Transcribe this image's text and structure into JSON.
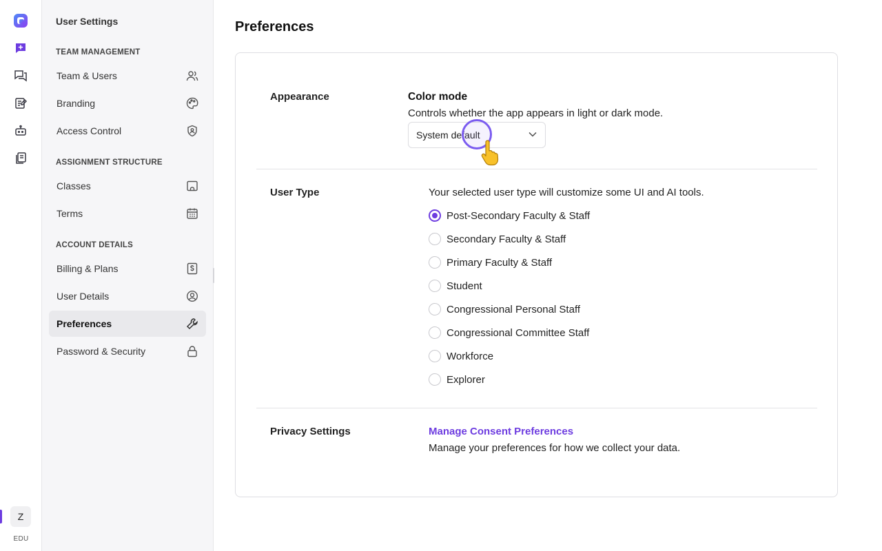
{
  "rail": {
    "items": [
      {
        "name": "logo-icon"
      },
      {
        "name": "new-chat-icon"
      },
      {
        "name": "chats-icon"
      },
      {
        "name": "notes-icon"
      },
      {
        "name": "bot-icon"
      },
      {
        "name": "documents-icon"
      }
    ],
    "avatar_letter": "Z",
    "plan_badge": "EDU",
    "accent_color": "#6d3ce0"
  },
  "sidebar": {
    "title": "User Settings",
    "sections": [
      {
        "heading": "TEAM MANAGEMENT",
        "items": [
          {
            "label": "Team & Users",
            "icon": "users-icon"
          },
          {
            "label": "Branding",
            "icon": "palette-icon"
          },
          {
            "label": "Access Control",
            "icon": "shield-icon"
          }
        ]
      },
      {
        "heading": "ASSIGNMENT STRUCTURE",
        "items": [
          {
            "label": "Classes",
            "icon": "classroom-icon"
          },
          {
            "label": "Terms",
            "icon": "calendar-icon"
          }
        ]
      },
      {
        "heading": "ACCOUNT DETAILS",
        "items": [
          {
            "label": "Billing & Plans",
            "icon": "dollar-icon"
          },
          {
            "label": "User Details",
            "icon": "user-circle-icon"
          },
          {
            "label": "Preferences",
            "icon": "wrench-icon",
            "active": true
          },
          {
            "label": "Password & Security",
            "icon": "lock-icon"
          }
        ]
      }
    ]
  },
  "main": {
    "title": "Preferences",
    "appearance": {
      "label": "Appearance",
      "color_mode_title": "Color mode",
      "color_mode_desc": "Controls whether the app appears in light or dark mode.",
      "selected": "System default"
    },
    "user_type": {
      "label": "User Type",
      "desc": "Your selected user type will customize some UI and AI tools.",
      "options": [
        {
          "label": "Post-Secondary Faculty & Staff",
          "checked": true
        },
        {
          "label": "Secondary Faculty & Staff",
          "checked": false
        },
        {
          "label": "Primary Faculty & Staff",
          "checked": false
        },
        {
          "label": "Student",
          "checked": false
        },
        {
          "label": "Congressional Personal Staff",
          "checked": false
        },
        {
          "label": "Congressional Committee Staff",
          "checked": false
        },
        {
          "label": "Workforce",
          "checked": false
        },
        {
          "label": "Explorer",
          "checked": false
        }
      ]
    },
    "privacy": {
      "label": "Privacy Settings",
      "link": "Manage Consent Preferences",
      "desc": "Manage your preferences for how we collect your data."
    }
  }
}
